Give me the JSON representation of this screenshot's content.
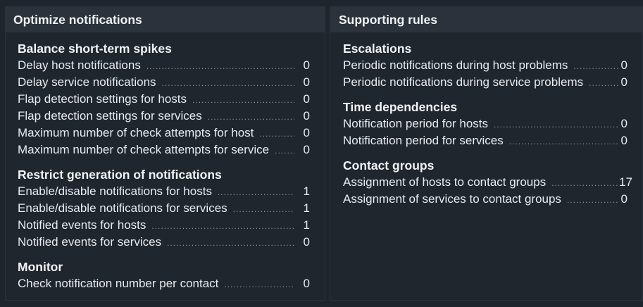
{
  "left_panel": {
    "title": "Optimize notifications",
    "sections": [
      {
        "title": "Balance short-term spikes",
        "rows": [
          {
            "label": "Delay host notifications",
            "count": "0"
          },
          {
            "label": "Delay service notifications",
            "count": "0"
          },
          {
            "label": "Flap detection settings for hosts",
            "count": "0"
          },
          {
            "label": "Flap detection settings for services",
            "count": "0"
          },
          {
            "label": "Maximum number of check attempts for host",
            "count": "0"
          },
          {
            "label": "Maximum number of check attempts for service",
            "count": "0"
          }
        ]
      },
      {
        "title": "Restrict generation of notifications",
        "rows": [
          {
            "label": "Enable/disable notifications for hosts",
            "count": "1"
          },
          {
            "label": "Enable/disable notifications for services",
            "count": "1"
          },
          {
            "label": "Notified events for hosts",
            "count": "1"
          },
          {
            "label": "Notified events for services",
            "count": "0"
          }
        ]
      },
      {
        "title": "Monitor",
        "rows": [
          {
            "label": "Check notification number per contact",
            "count": "0"
          }
        ]
      }
    ]
  },
  "right_panel": {
    "title": "Supporting rules",
    "sections": [
      {
        "title": "Escalations",
        "rows": [
          {
            "label": "Periodic notifications during host problems",
            "count": "0"
          },
          {
            "label": "Periodic notifications during service problems",
            "count": "0"
          }
        ]
      },
      {
        "title": "Time dependencies",
        "rows": [
          {
            "label": "Notification period for hosts",
            "count": "0"
          },
          {
            "label": "Notification period for services",
            "count": "0"
          }
        ]
      },
      {
        "title": "Contact groups",
        "rows": [
          {
            "label": "Assignment of hosts to contact groups",
            "count": "17"
          },
          {
            "label": "Assignment of services to contact groups",
            "count": "0"
          }
        ]
      }
    ]
  }
}
